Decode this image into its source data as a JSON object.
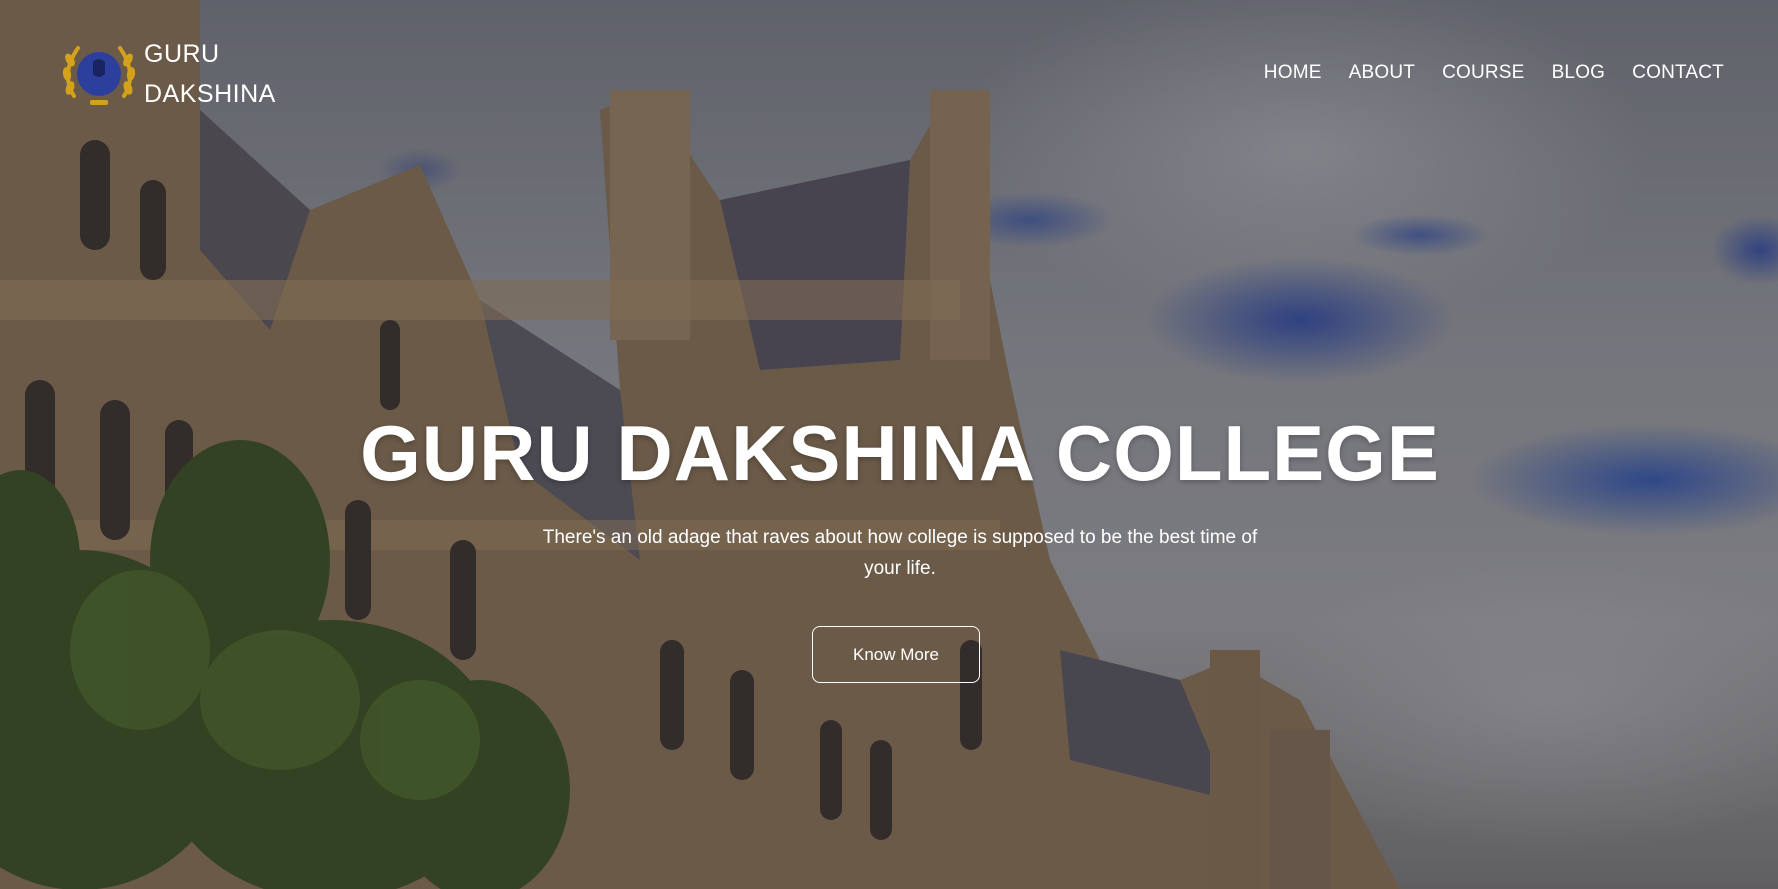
{
  "brand": {
    "line1": "GURU",
    "line2": "DAKSHINA",
    "emblem_icon": "laurel-emblem-icon"
  },
  "nav": {
    "items": [
      {
        "label": "HOME"
      },
      {
        "label": "ABOUT"
      },
      {
        "label": "COURSE"
      },
      {
        "label": "BLOG"
      },
      {
        "label": "CONTACT"
      }
    ]
  },
  "hero": {
    "title": "GURU DAKSHINA COLLEGE",
    "subtitle": "There's an old adage that raves about how college is supposed to be the best time of your life.",
    "cta_label": "Know More"
  },
  "colors": {
    "text": "#ffffff",
    "emblem_gold": "#d4a21a",
    "emblem_blue": "#2c3f9c"
  }
}
